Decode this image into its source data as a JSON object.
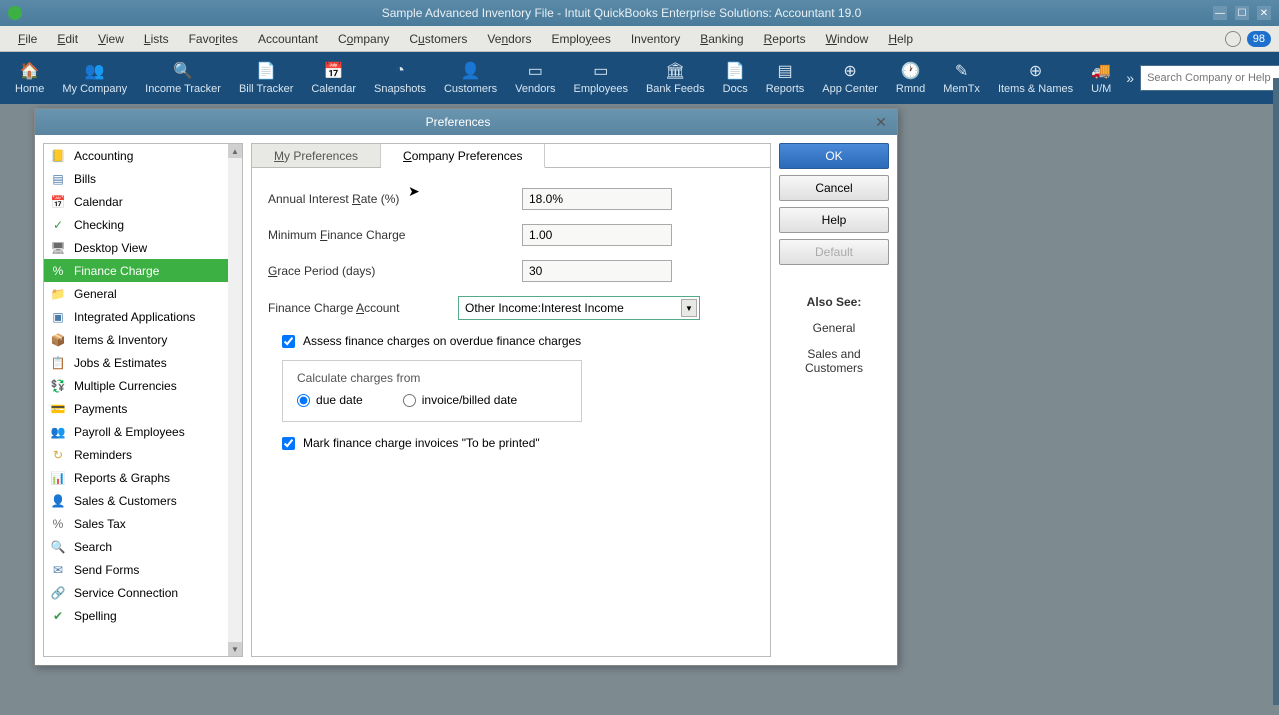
{
  "window": {
    "title": "Sample Advanced Inventory File  - Intuit QuickBooks Enterprise Solutions: Accountant 19.0"
  },
  "menubar": {
    "items": [
      "File",
      "Edit",
      "View",
      "Lists",
      "Favorites",
      "Accountant",
      "Company",
      "Customers",
      "Vendors",
      "Employees",
      "Inventory",
      "Banking",
      "Reports",
      "Window",
      "Help"
    ],
    "badge": "98"
  },
  "toolbar": {
    "items": [
      {
        "label": "Home",
        "icon": "🏠"
      },
      {
        "label": "My Company",
        "icon": "👥"
      },
      {
        "label": "Income Tracker",
        "icon": "🔍"
      },
      {
        "label": "Bill Tracker",
        "icon": "📄"
      },
      {
        "label": "Calendar",
        "icon": "📅"
      },
      {
        "label": "Snapshots",
        "icon": "◔"
      },
      {
        "label": "Customers",
        "icon": "👤"
      },
      {
        "label": "Vendors",
        "icon": "▭"
      },
      {
        "label": "Employees",
        "icon": "▭"
      },
      {
        "label": "Bank Feeds",
        "icon": "🏛"
      },
      {
        "label": "Docs",
        "icon": "📄"
      },
      {
        "label": "Reports",
        "icon": "▤"
      },
      {
        "label": "App Center",
        "icon": "⊕"
      },
      {
        "label": "Rmnd",
        "icon": "🕐"
      },
      {
        "label": "MemTx",
        "icon": "✎"
      },
      {
        "label": "Items & Names",
        "icon": "⊕"
      },
      {
        "label": "U/M",
        "icon": "🚚"
      }
    ],
    "search_placeholder": "Search Company or Help"
  },
  "dialog": {
    "title": "Preferences",
    "sidebar": [
      {
        "label": "Accounting",
        "icon": "📒",
        "color": "#d4a83a"
      },
      {
        "label": "Bills",
        "icon": "▤",
        "color": "#4a7aa8"
      },
      {
        "label": "Calendar",
        "icon": "📅",
        "color": "#4a7aa8"
      },
      {
        "label": "Checking",
        "icon": "✓",
        "color": "#3a9a4a"
      },
      {
        "label": "Desktop View",
        "icon": "🖥",
        "color": "#6a6a6a"
      },
      {
        "label": "Finance Charge",
        "icon": "%",
        "color": "#8a4aa8",
        "selected": true
      },
      {
        "label": "General",
        "icon": "📁",
        "color": "#d4a83a"
      },
      {
        "label": "Integrated Applications",
        "icon": "▣",
        "color": "#4a7aa8"
      },
      {
        "label": "Items & Inventory",
        "icon": "📦",
        "color": "#d48a3a"
      },
      {
        "label": "Jobs & Estimates",
        "icon": "📋",
        "color": "#d4a83a"
      },
      {
        "label": "Multiple Currencies",
        "icon": "💱",
        "color": "#3a9a4a"
      },
      {
        "label": "Payments",
        "icon": "💳",
        "color": "#3a9a4a"
      },
      {
        "label": "Payroll & Employees",
        "icon": "👥",
        "color": "#d48a3a"
      },
      {
        "label": "Reminders",
        "icon": "↻",
        "color": "#d4a83a"
      },
      {
        "label": "Reports & Graphs",
        "icon": "📊",
        "color": "#3a5aa8"
      },
      {
        "label": "Sales & Customers",
        "icon": "👤",
        "color": "#d48a3a"
      },
      {
        "label": "Sales Tax",
        "icon": "%",
        "color": "#6a6a6a"
      },
      {
        "label": "Search",
        "icon": "🔍",
        "color": "#6a6a6a"
      },
      {
        "label": "Send Forms",
        "icon": "✉",
        "color": "#4a7aa8"
      },
      {
        "label": "Service Connection",
        "icon": "🔗",
        "color": "#4a7aa8"
      },
      {
        "label": "Spelling",
        "icon": "✔",
        "color": "#3a9a4a"
      }
    ],
    "tabs": {
      "my_prefs": "My Preferences",
      "company_prefs": "Company Preferences"
    },
    "form": {
      "annual_rate_label": "Annual Interest Rate (%)",
      "annual_rate_value": "18.0%",
      "min_charge_label": "Minimum Finance Charge",
      "min_charge_value": "1.00",
      "grace_label": "Grace Period (days)",
      "grace_value": "30",
      "account_label": "Finance Charge Account",
      "account_value": "Other Income:Interest Income",
      "assess_label": "Assess finance charges on overdue finance charges",
      "calc_title": "Calculate charges from",
      "due_date_label": "due date",
      "invoice_date_label": "invoice/billed date",
      "mark_print_label": "Mark finance charge invoices \"To be printed\""
    },
    "buttons": {
      "ok": "OK",
      "cancel": "Cancel",
      "help": "Help",
      "default": "Default"
    },
    "also_see": {
      "title": "Also See:",
      "links": [
        "General",
        "Sales and Customers"
      ]
    }
  }
}
